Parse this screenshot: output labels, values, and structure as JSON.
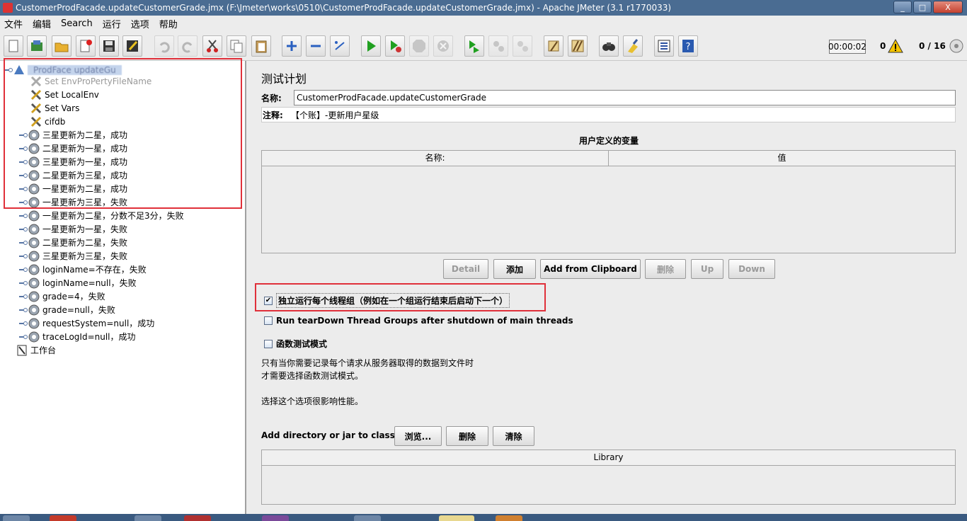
{
  "window": {
    "title": "CustomerProdFacade.updateCustomerGrade.jmx (F:\\Jmeter\\works\\0510\\CustomerProdFacade.updateCustomerGrade.jmx) - Apache JMeter (3.1 r1770033)",
    "minimize": "_",
    "maximize": "□",
    "close": "X"
  },
  "menu": [
    "文件",
    "编辑",
    "Search",
    "运行",
    "选项",
    "帮助"
  ],
  "toolbar": {
    "icons": [
      "new-icon",
      "templates-icon",
      "open-icon",
      "close-file-icon",
      "save-icon",
      "save-as-icon",
      "undo-icon",
      "redo-icon",
      "cut-icon",
      "copy-icon",
      "paste-icon",
      "expand-icon",
      "collapse-icon",
      "toggle-icon",
      "start-icon",
      "start-no-pause-icon",
      "stop-icon",
      "shutdown-icon",
      "remote-start-icon",
      "remote-stop-icon",
      "remote-shutdown-icon",
      "clear-icon",
      "clear-all-icon",
      "search-icon",
      "reset-search-icon",
      "function-helper-icon",
      "help-icon"
    ]
  },
  "status": {
    "timer": "00:00:02",
    "errors": "0",
    "threads": "0 / 16"
  },
  "tree": {
    "root_label": "ProdFace  updateGu",
    "items": [
      {
        "label": "Set EnvProPertyFileName",
        "type": "config",
        "disabled": true
      },
      {
        "label": "Set LocalEnv",
        "type": "config",
        "disabled": false
      },
      {
        "label": "Set Vars",
        "type": "config",
        "disabled": false
      },
      {
        "label": "cifdb",
        "type": "config",
        "disabled": false
      },
      {
        "label": "三星更新为二星，成功",
        "type": "thread"
      },
      {
        "label": "二星更新为一星，成功",
        "type": "thread"
      },
      {
        "label": "三星更新为一星，成功",
        "type": "thread"
      },
      {
        "label": "二星更新为三星，成功",
        "type": "thread"
      },
      {
        "label": "一星更新为二星，成功",
        "type": "thread"
      },
      {
        "label": "一星更新为三星，失败",
        "type": "thread"
      },
      {
        "label": "一星更新为二星，分数不足3分，失败",
        "type": "thread"
      },
      {
        "label": "一星更新为一星，失败",
        "type": "thread"
      },
      {
        "label": "二星更新为二星，失败",
        "type": "thread"
      },
      {
        "label": "三星更新为三星，失败",
        "type": "thread"
      },
      {
        "label": "loginName=不存在，失败",
        "type": "thread"
      },
      {
        "label": "loginName=null，失败",
        "type": "thread"
      },
      {
        "label": "grade=4，失败",
        "type": "thread"
      },
      {
        "label": "grade=null，失败",
        "type": "thread"
      },
      {
        "label": "requestSystem=null，成功",
        "type": "thread"
      },
      {
        "label": "traceLogId=null，成功",
        "type": "thread"
      }
    ],
    "workbench": "工作台"
  },
  "plan": {
    "title": "测试计划",
    "name_label": "名称:",
    "name_value": "CustomerProdFacade.updateCustomerGrade",
    "comment_label": "注释:",
    "comment_value": "【个账】-更新用户星级",
    "vars_title": "用户定义的变量",
    "col_name": "名称:",
    "col_value": "值",
    "buttons": {
      "detail": "Detail",
      "add": "添加",
      "add_clipboard": "Add from Clipboard",
      "delete": "删除",
      "up": "Up",
      "down": "Down"
    },
    "serialize_label": "独立运行每个线程组（例如在一个组运行结束后启动下一个）",
    "serialize_checked": true,
    "teardown_label": "Run tearDown Thread Groups after shutdown of main threads",
    "teardown_checked": false,
    "functional_label": "函数测试模式",
    "functional_checked": false,
    "info_line1": "只有当你需要记录每个请求从服务器取得的数据到文件时",
    "info_line2": "才需要选择函数测试模式。",
    "info_line3": "选择这个选项很影响性能。",
    "classpath_label": "Add directory or jar to classpath",
    "browse": "浏览...",
    "cp_delete": "删除",
    "cp_clear": "清除",
    "library_header": "Library"
  },
  "colors": {
    "highlight_box": "#e0303a",
    "titlebar": "#4a6c92"
  }
}
